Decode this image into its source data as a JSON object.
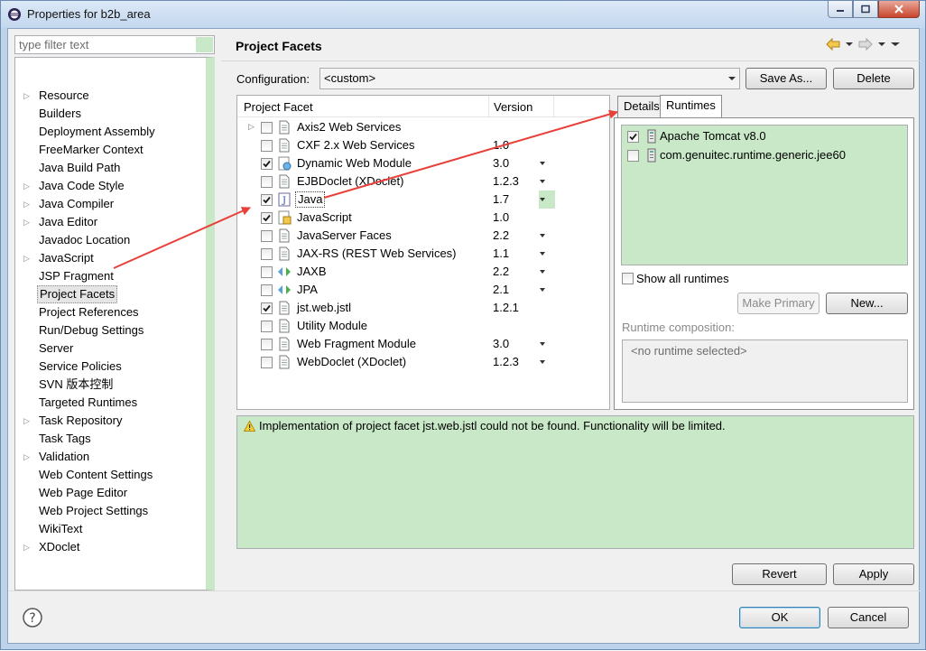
{
  "window": {
    "title": "Properties for b2b_area"
  },
  "nav": {
    "filter_placeholder": "type filter text",
    "items": [
      {
        "label": "Resource",
        "expandable": true
      },
      {
        "label": "Builders",
        "expandable": false
      },
      {
        "label": "Deployment Assembly",
        "expandable": false
      },
      {
        "label": "FreeMarker Context",
        "expandable": false
      },
      {
        "label": "Java Build Path",
        "expandable": false
      },
      {
        "label": "Java Code Style",
        "expandable": true
      },
      {
        "label": "Java Compiler",
        "expandable": true
      },
      {
        "label": "Java Editor",
        "expandable": true
      },
      {
        "label": "Javadoc Location",
        "expandable": false
      },
      {
        "label": "JavaScript",
        "expandable": true
      },
      {
        "label": "JSP Fragment",
        "expandable": false
      },
      {
        "label": "Project Facets",
        "expandable": false,
        "selected": true
      },
      {
        "label": "Project References",
        "expandable": false
      },
      {
        "label": "Run/Debug Settings",
        "expandable": false
      },
      {
        "label": "Server",
        "expandable": false
      },
      {
        "label": "Service Policies",
        "expandable": false
      },
      {
        "label": "SVN 版本控制",
        "expandable": false
      },
      {
        "label": "Targeted Runtimes",
        "expandable": false
      },
      {
        "label": "Task Repository",
        "expandable": true
      },
      {
        "label": "Task Tags",
        "expandable": false
      },
      {
        "label": "Validation",
        "expandable": true
      },
      {
        "label": "Web Content Settings",
        "expandable": false
      },
      {
        "label": "Web Page Editor",
        "expandable": false
      },
      {
        "label": "Web Project Settings",
        "expandable": false
      },
      {
        "label": "WikiText",
        "expandable": false
      },
      {
        "label": "XDoclet",
        "expandable": true
      }
    ]
  },
  "page": {
    "title": "Project Facets",
    "configuration_label": "Configuration:",
    "configuration_value": "<custom>",
    "save_as_label": "Save As...",
    "delete_label": "Delete"
  },
  "facets": {
    "col_facet": "Project Facet",
    "col_version": "Version",
    "rows": [
      {
        "name": "Axis2 Web Services",
        "version": "",
        "checked": false,
        "expandable": true,
        "dropdown": false,
        "icon": "page-icon"
      },
      {
        "name": "CXF 2.x Web Services",
        "version": "1.0",
        "checked": false,
        "expandable": false,
        "dropdown": false,
        "icon": "page-icon"
      },
      {
        "name": "Dynamic Web Module",
        "version": "3.0",
        "checked": true,
        "expandable": false,
        "dropdown": true,
        "icon": "web-module-icon"
      },
      {
        "name": "EJBDoclet (XDoclet)",
        "version": "1.2.3",
        "checked": false,
        "expandable": false,
        "dropdown": true,
        "icon": "page-icon"
      },
      {
        "name": "Java",
        "version": "1.7",
        "checked": true,
        "expandable": false,
        "dropdown": true,
        "icon": "java-icon",
        "selected": true
      },
      {
        "name": "JavaScript",
        "version": "1.0",
        "checked": true,
        "expandable": false,
        "dropdown": false,
        "icon": "javascript-icon"
      },
      {
        "name": "JavaServer Faces",
        "version": "2.2",
        "checked": false,
        "expandable": false,
        "dropdown": true,
        "icon": "page-icon"
      },
      {
        "name": "JAX-RS (REST Web Services)",
        "version": "1.1",
        "checked": false,
        "expandable": false,
        "dropdown": true,
        "icon": "page-icon"
      },
      {
        "name": "JAXB",
        "version": "2.2",
        "checked": false,
        "expandable": false,
        "dropdown": true,
        "icon": "jaxb-icon"
      },
      {
        "name": "JPA",
        "version": "2.1",
        "checked": false,
        "expandable": false,
        "dropdown": true,
        "icon": "jpa-icon"
      },
      {
        "name": "jst.web.jstl",
        "version": "1.2.1",
        "checked": true,
        "expandable": false,
        "dropdown": false,
        "icon": "page-icon"
      },
      {
        "name": "Utility Module",
        "version": "",
        "checked": false,
        "expandable": false,
        "dropdown": false,
        "icon": "page-icon"
      },
      {
        "name": "Web Fragment Module",
        "version": "3.0",
        "checked": false,
        "expandable": false,
        "dropdown": true,
        "icon": "page-icon"
      },
      {
        "name": "WebDoclet (XDoclet)",
        "version": "1.2.3",
        "checked": false,
        "expandable": false,
        "dropdown": true,
        "icon": "page-icon"
      }
    ]
  },
  "tabs": {
    "details": "Details",
    "runtimes": "Runtimes"
  },
  "runtimes": {
    "items": [
      {
        "name": "Apache Tomcat v8.0",
        "checked": true
      },
      {
        "name": "com.genuitec.runtime.generic.jee60",
        "checked": false
      }
    ],
    "show_all_label": "Show all runtimes",
    "make_primary_label": "Make Primary",
    "new_label": "New...",
    "composition_label": "Runtime composition:",
    "composition_empty": "<no runtime selected>"
  },
  "message": {
    "text": "Implementation of project facet jst.web.jstl could not be found. Functionality will be limited."
  },
  "buttons": {
    "revert": "Revert",
    "apply": "Apply",
    "ok": "OK",
    "cancel": "Cancel"
  },
  "colors": {
    "highlight_green": "#c8e8c8",
    "annotation_red": "#e8413a",
    "warning_yellow": "#f2d23b"
  }
}
